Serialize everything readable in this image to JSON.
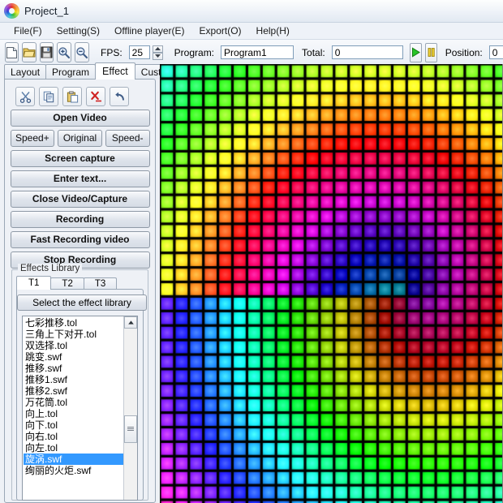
{
  "window": {
    "title": "Project_1",
    "logo_icon": "rainbow-spiral-logo"
  },
  "menubar": [
    {
      "label": "File(F)"
    },
    {
      "label": "Setting(S)"
    },
    {
      "label": "Offline player(E)"
    },
    {
      "label": "Export(O)"
    },
    {
      "label": "Help(H)"
    }
  ],
  "toolbar": {
    "icons": [
      "new-file-icon",
      "open-folder-icon",
      "save-disk-icon",
      "zoom-in-icon",
      "zoom-out-icon"
    ],
    "fps_label": "FPS:",
    "fps_value": "25",
    "program_label": "Program:",
    "program_value": "Program1",
    "total_label": "Total:",
    "total_value": "0",
    "play_icon": "play-icon",
    "pause_icon": "pause-icon",
    "position_label": "Position:",
    "position_value": "0"
  },
  "tabs": [
    {
      "label": "Layout",
      "active": false
    },
    {
      "label": "Program",
      "active": false
    },
    {
      "label": "Effect",
      "active": true
    },
    {
      "label": "Custom",
      "active": false
    }
  ],
  "edit_tools": [
    "cut-icon",
    "copy-icon",
    "paste-icon",
    "delete-icon",
    "undo-icon"
  ],
  "effect_buttons": {
    "open_video": "Open Video",
    "speed_up": "Speed+",
    "original": "Original",
    "speed_down": "Speed-",
    "screen_capture": "Screen capture",
    "enter_text": "Enter text...",
    "close_video": "Close Video/Capture",
    "recording": "Recording",
    "fast_recording": "Fast Recording video",
    "stop_recording": "Stop Recording"
  },
  "effects_library": {
    "group_title": "Effects Library",
    "subtabs": [
      {
        "label": "T1",
        "active": true
      },
      {
        "label": "T2",
        "active": false
      },
      {
        "label": "T3",
        "active": false
      }
    ],
    "select_button": "Select the effect library",
    "files": [
      {
        "name": "七彩推移.tol",
        "selected": false
      },
      {
        "name": "三角上下对开.tol",
        "selected": false
      },
      {
        "name": "双选择.tol",
        "selected": false
      },
      {
        "name": "跳变.swf",
        "selected": false
      },
      {
        "name": "推移.swf",
        "selected": false
      },
      {
        "name": "推移1.swf",
        "selected": false
      },
      {
        "name": "推移2.swf",
        "selected": false
      },
      {
        "name": "万花筒.tol",
        "selected": false
      },
      {
        "name": "向上.tol",
        "selected": false
      },
      {
        "name": "向下.tol",
        "selected": false
      },
      {
        "name": "向右.tol",
        "selected": false
      },
      {
        "name": "向左.tol",
        "selected": false
      },
      {
        "name": "旋涡.swf",
        "selected": true
      },
      {
        "name": "绚丽的火炬.swf",
        "selected": false
      }
    ],
    "scroll_up_icon": "scroll-up-arrow-icon",
    "scroll_thumb_icon": "scroll-thumb-grip"
  },
  "preview": {
    "name": "led-matrix-preview",
    "cols": 28,
    "rows": 34,
    "cell": 14.7,
    "gap": 3.2,
    "background": "#000000",
    "surround": "#808080",
    "pattern": "radial-rainbow-vortex"
  }
}
